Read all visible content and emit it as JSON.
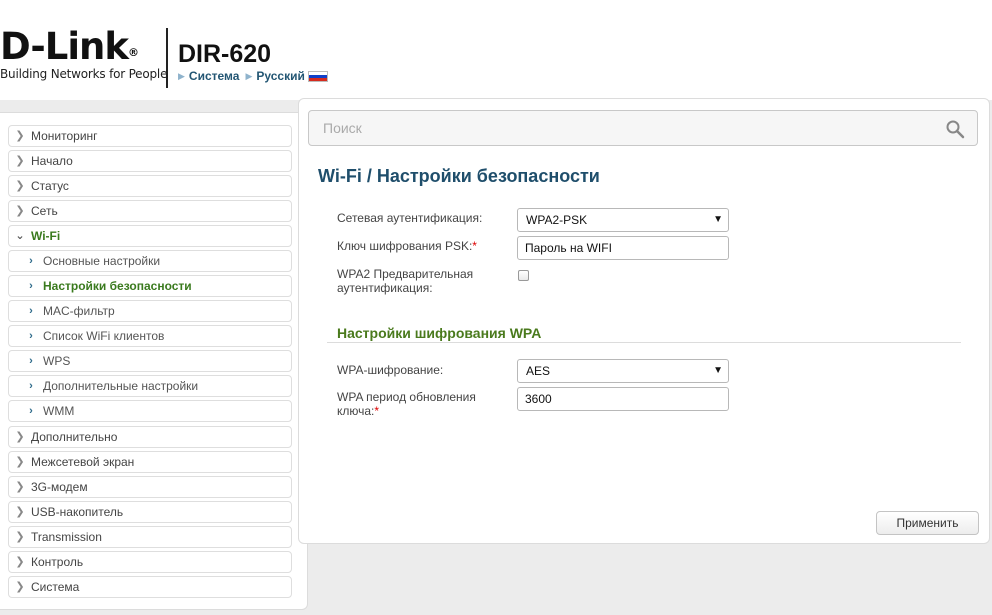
{
  "header": {
    "logo_text": "D-Link",
    "logo_reg": "®",
    "logo_tagline": "Building Networks for People",
    "model": "DIR-620",
    "breadcrumbs": [
      "Система",
      "Русский"
    ]
  },
  "sidebar": {
    "items": [
      {
        "label": "Мониторинг"
      },
      {
        "label": "Начало"
      },
      {
        "label": "Статус"
      },
      {
        "label": "Сеть"
      },
      {
        "label": "Wi-Fi"
      },
      {
        "label": "Основные настройки"
      },
      {
        "label": "Настройки безопасности"
      },
      {
        "label": "MAC-фильтр"
      },
      {
        "label": "Список WiFi клиентов"
      },
      {
        "label": "WPS"
      },
      {
        "label": "Дополнительные настройки"
      },
      {
        "label": "WMM"
      },
      {
        "label": "Дополнительно"
      },
      {
        "label": "Межсетевой экран"
      },
      {
        "label": "3G-модем"
      },
      {
        "label": "USB-накопитель"
      },
      {
        "label": "Transmission"
      },
      {
        "label": "Контроль"
      },
      {
        "label": "Система"
      }
    ]
  },
  "search": {
    "placeholder": "Поиск",
    "icon": "search-icon"
  },
  "page": {
    "title_prefix": "Wi-Fi /",
    "title": "Настройки безопасности"
  },
  "form": {
    "auth_label": "Сетевая аутентификация:",
    "auth_value": "WPA2-PSK",
    "psk_label": "Ключ шифрования PSK:",
    "psk_required": "*",
    "psk_value": "Пароль на WIFI",
    "preauth_label_line1": "WPA2 Предварительная",
    "preauth_label_line2": "аутентификация:",
    "preauth_checked": false
  },
  "wpa_section": {
    "title": "Настройки шифрования WPA",
    "encryption_label": "WPA-шифрование:",
    "encryption_value": "AES",
    "period_label_line1": "WPA период обновления",
    "period_label_line2": "ключа:",
    "period_required": "*",
    "period_value": "3600"
  },
  "actions": {
    "apply_label": "Применить"
  },
  "colors": {
    "title_blue": "#1f4e6b",
    "section_green": "#4a7a1d",
    "active_green": "#3a7a1e",
    "required_red": "#dd0000"
  }
}
